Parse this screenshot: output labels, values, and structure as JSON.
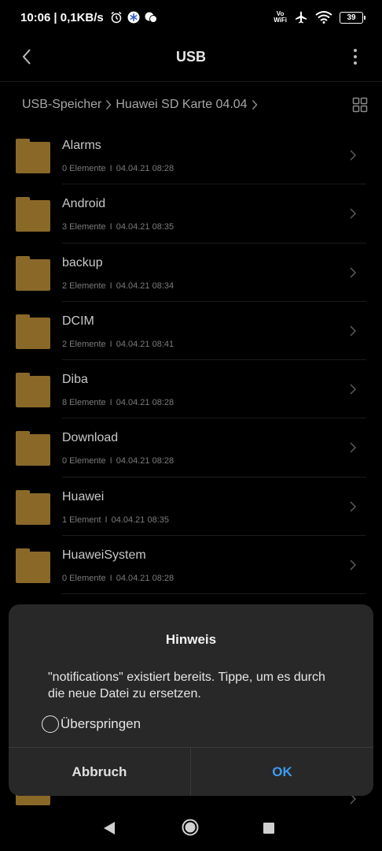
{
  "status_bar": {
    "time": "10:06",
    "speed": "| 0,1KB/s",
    "vowifi_top": "Vo",
    "vowifi_bottom": "WiFi",
    "battery": "39"
  },
  "header": {
    "title": "USB"
  },
  "breadcrumb": {
    "items": [
      "USB-Speicher",
      "Huawei SD Karte 04.04"
    ]
  },
  "files": [
    {
      "name": "Alarms",
      "count": "0 Elemente",
      "date": "04.04.21 08:28"
    },
    {
      "name": "Android",
      "count": "3 Elemente",
      "date": "04.04.21 08:35"
    },
    {
      "name": "backup",
      "count": "2 Elemente",
      "date": "04.04.21 08:34"
    },
    {
      "name": "DCIM",
      "count": "2 Elemente",
      "date": "04.04.21 08:41"
    },
    {
      "name": "Diba",
      "count": "8 Elemente",
      "date": "04.04.21 08:28"
    },
    {
      "name": "Download",
      "count": "0 Elemente",
      "date": "04.04.21 08:28"
    },
    {
      "name": "Huawei",
      "count": "1 Element",
      "date": "04.04.21 08:35"
    },
    {
      "name": "HuaweiSystem",
      "count": "0 Elemente",
      "date": "04.04.21 08:28"
    }
  ],
  "dialog": {
    "title": "Hinweis",
    "message": "\"notifications\" existiert bereits. Tippe, um es durch die neue Datei zu ersetzen.",
    "skip_label": "Überspringen",
    "cancel_label": "Abbruch",
    "ok_label": "OK"
  },
  "colors": {
    "folder": "#8a6828",
    "accent": "#3d9bf0",
    "dialog_bg": "#282828"
  }
}
